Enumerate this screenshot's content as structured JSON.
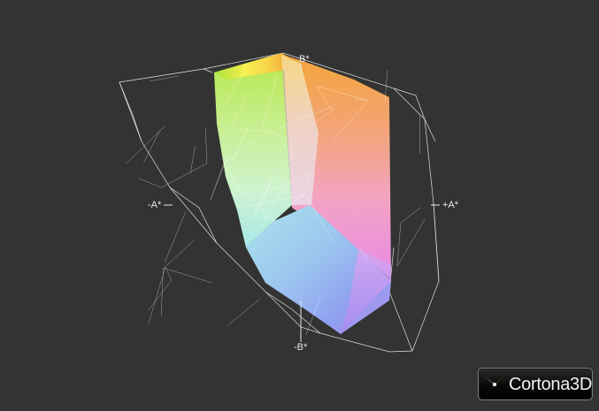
{
  "viewer": {
    "axis_labels": {
      "b_plus": "B*",
      "a_minus": "-A*",
      "a_plus": "+A*",
      "b_minus": "-B*"
    },
    "logo": {
      "brand": "Cortona3D",
      "icon": "cortona-star-icon"
    },
    "colors": {
      "background": "#333333",
      "wireframe": "#ffffff"
    }
  }
}
